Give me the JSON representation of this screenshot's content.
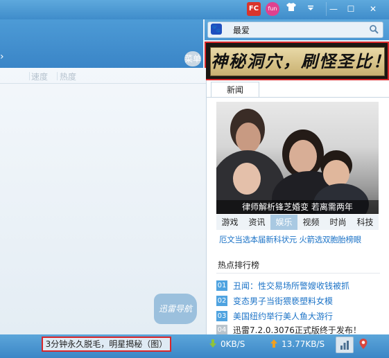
{
  "titlebar": {
    "fc_label": "FC",
    "fun_label": "fun",
    "shirt_icon": "shirt-icon",
    "dropdown_icon": "chevron-down-icon",
    "minimize_glyph": "—",
    "maximize_glyph": "☐",
    "close_glyph": "✕"
  },
  "search": {
    "value": "最爱",
    "engine_icon": "paw-icon"
  },
  "banner": {
    "text": "神秘洞穴，刷怪圣比！"
  },
  "main": {
    "menu_label": "菜单",
    "columns": [
      "速度",
      "热度"
    ],
    "nav_bubble": "迅雷导航"
  },
  "news": {
    "tab_label": "新闻",
    "photo_caption": "律师解析锋芝婚变 若离需两年",
    "categories": [
      "游戏",
      "资讯",
      "娱乐",
      "视频",
      "时尚",
      "科技"
    ],
    "active_category": "娱乐",
    "headline": "厄文当选本届新科状元 火箭选双胞胎榜眼",
    "hot_title": "热点排行榜",
    "hot_items": [
      {
        "num": "01",
        "text": "丑闻：性交易场所警嫂收钱被抓"
      },
      {
        "num": "02",
        "text": "变态男子当街猥亵塑料女模"
      },
      {
        "num": "03",
        "text": "美国纽约举行美人鱼大游行"
      },
      {
        "num": "04",
        "text": "迅雷7.2.0.3076正式版终于发布！"
      }
    ]
  },
  "statusbar": {
    "promo": "3分钟永久脱毛，明星揭秘（图）",
    "download_speed": "0KB/S",
    "upload_speed": "13.77KB/S"
  },
  "colors": {
    "titlebar_blue": "#3f8cca",
    "link_blue": "#1c73c7",
    "highlight_red": "#d9262a"
  }
}
